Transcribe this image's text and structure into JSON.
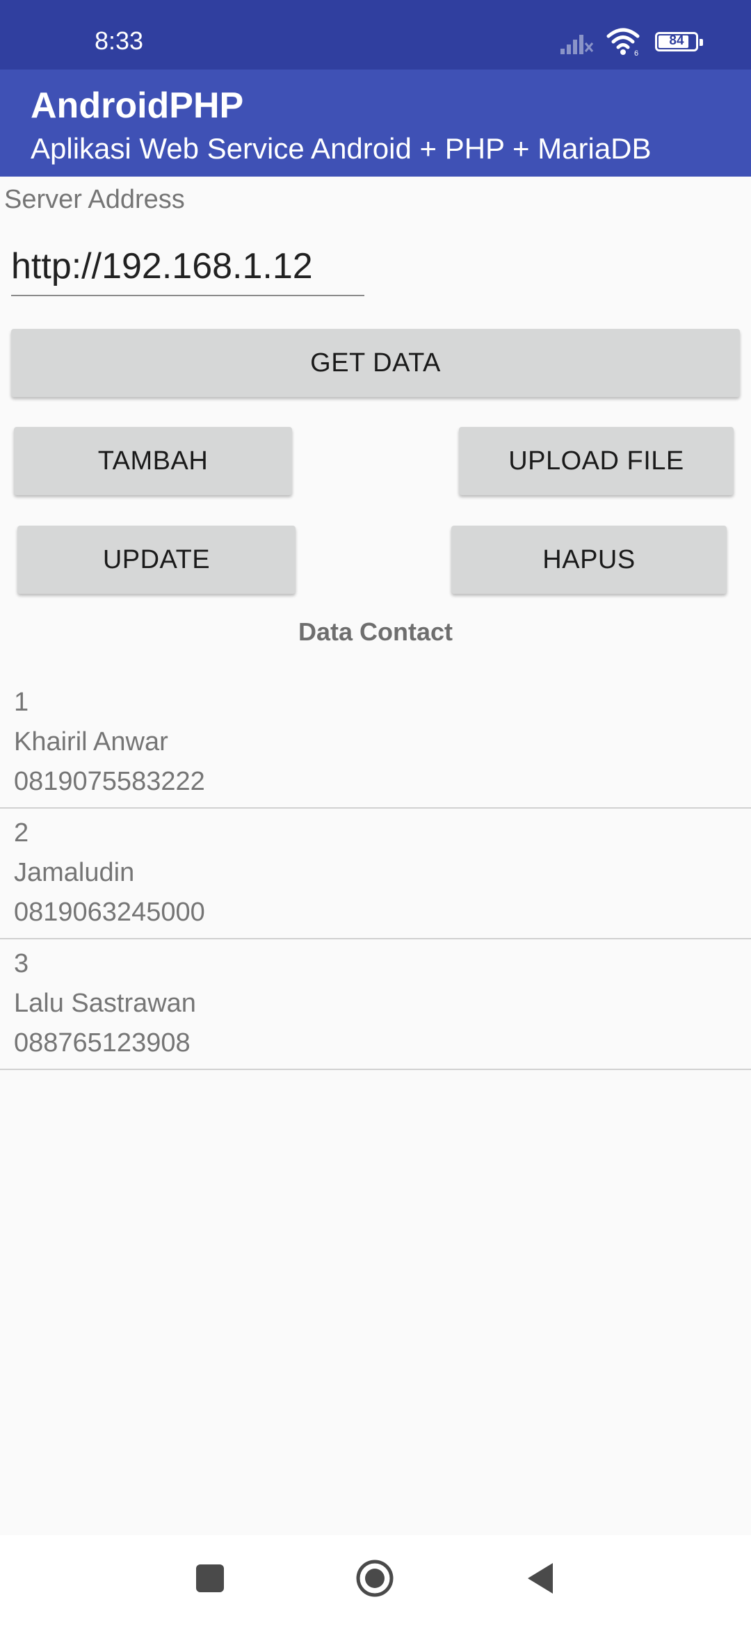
{
  "status": {
    "time": "8:33",
    "battery": "84",
    "battery_level": 0.84
  },
  "appbar": {
    "title": "AndroidPHP",
    "subtitle": "Aplikasi Web Service Android + PHP + MariaDB"
  },
  "server": {
    "label": "Server Address",
    "value": "http://192.168.1.12"
  },
  "buttons": {
    "get_data": "GET DATA",
    "tambah": "TAMBAH",
    "upload_file": "UPLOAD FILE",
    "update": "UPDATE",
    "hapus": "HAPUS"
  },
  "section_title": "Data Contact",
  "contacts": [
    {
      "id": "1",
      "name": "Khairil Anwar",
      "phone": "0819075583222"
    },
    {
      "id": "2",
      "name": "Jamaludin",
      "phone": "0819063245000"
    },
    {
      "id": "3",
      "name": "Lalu Sastrawan",
      "phone": "088765123908"
    }
  ],
  "colors": {
    "status_bar": "#303f9f",
    "app_bar": "#3f51b5",
    "button": "#d6d7d7",
    "background": "#fafafa"
  },
  "icons": {
    "signal": "signal-icon",
    "wifi": "wifi-icon",
    "battery": "battery-icon",
    "nav_recent": "recent-apps-icon",
    "nav_home": "home-icon",
    "nav_back": "back-icon"
  }
}
